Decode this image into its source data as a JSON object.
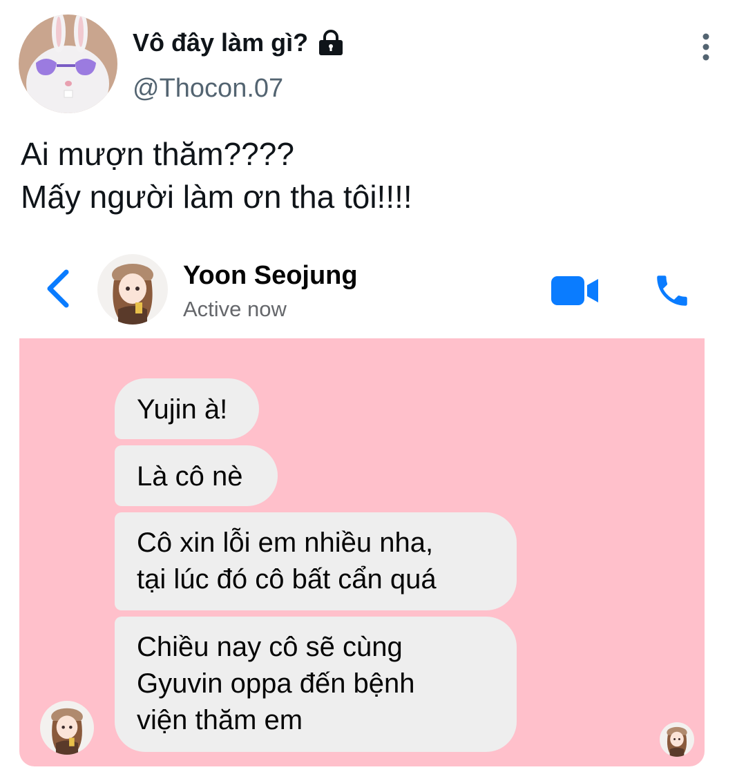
{
  "tweet": {
    "author_name": "Vô đây làm gì?",
    "handle": "@Thocon.07",
    "text_lines": [
      "Ai mượn thăm????",
      "Mấy người làm ơn tha tôi!!!!"
    ],
    "icons": {
      "lock": "lock-icon",
      "more": "more-vertical-icon"
    }
  },
  "messenger": {
    "contact_name": "Yoon Seojung",
    "status": "Active now",
    "accent_color": "#0a7cff",
    "chat_background": "#ffc0cb",
    "icons": {
      "back": "chevron-left-icon",
      "video": "video-camera-icon",
      "call": "phone-icon"
    },
    "messages": [
      {
        "lines": [
          "Yujin à!"
        ]
      },
      {
        "lines": [
          "Là cô nè"
        ]
      },
      {
        "lines": [
          "Cô xin lỗi em nhiều nha,",
          "tại lúc đó cô bất cẩn quá"
        ]
      },
      {
        "lines": [
          "Chiều nay cô sẽ cùng",
          "Gyuvin oppa đến bệnh",
          "viện thăm em"
        ]
      }
    ]
  }
}
